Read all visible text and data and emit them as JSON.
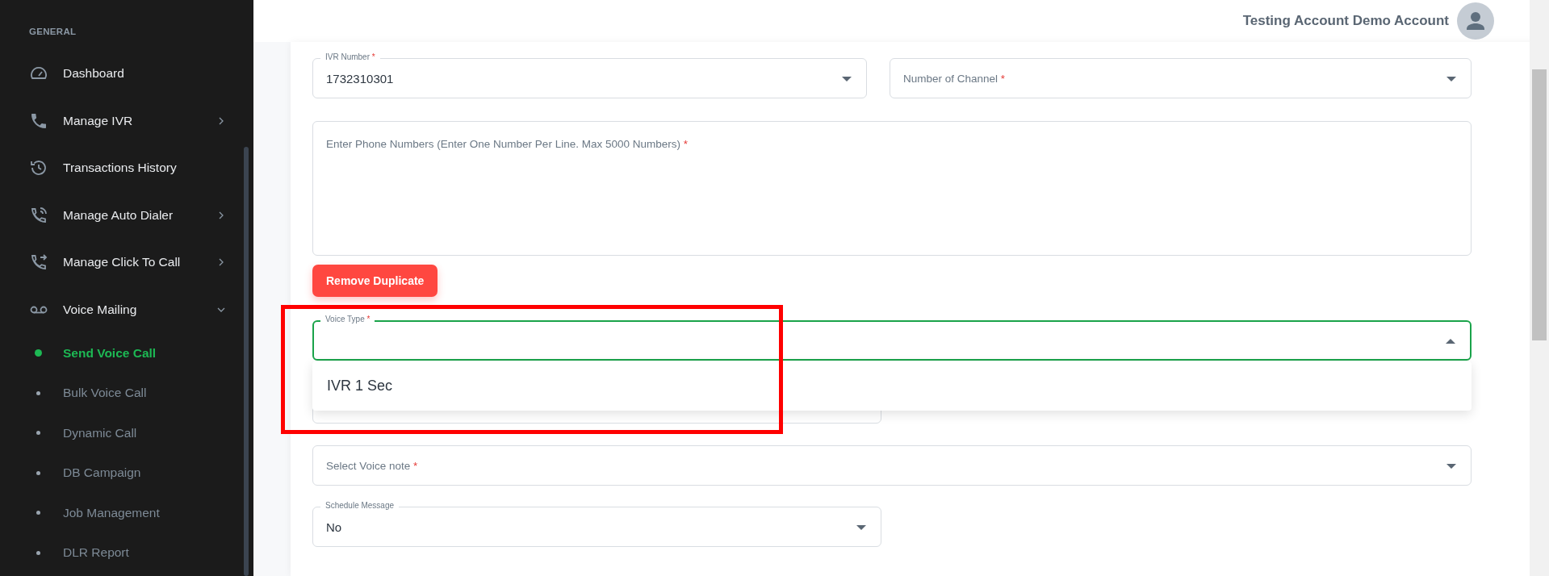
{
  "sidebar": {
    "section": "GENERAL",
    "items": [
      {
        "label": "Dashboard"
      },
      {
        "label": "Manage IVR",
        "expanded": false
      },
      {
        "label": "Transactions History"
      },
      {
        "label": "Manage Auto Dialer",
        "expanded": false
      },
      {
        "label": "Manage Click To Call",
        "expanded": false
      },
      {
        "label": "Voice Mailing",
        "expanded": true,
        "children": [
          {
            "label": "Send Voice Call",
            "selected": true
          },
          {
            "label": "Bulk Voice Call",
            "selected": false
          },
          {
            "label": "Dynamic Call",
            "selected": false
          },
          {
            "label": "DB Campaign",
            "selected": false
          },
          {
            "label": "Job Management",
            "selected": false
          },
          {
            "label": "DLR Report",
            "selected": false
          }
        ]
      }
    ]
  },
  "header": {
    "user_name": "Testing Account Demo Account"
  },
  "form": {
    "ivr_number": {
      "label": "IVR Number",
      "required_mark": "*",
      "value": "1732310301"
    },
    "number_of_channel": {
      "placeholder": "Number of Channel",
      "required_mark": "*"
    },
    "phone_numbers": {
      "placeholder": "Enter Phone Numbers (Enter One Number Per Line. Max 5000 Numbers)",
      "required_mark": "*"
    },
    "remove_duplicate_button": "Remove Duplicate",
    "voice_type": {
      "label": "Voice Type",
      "required_mark": "*",
      "focused": true,
      "options": [
        "IVR 1 Sec"
      ]
    },
    "voice_note": {
      "placeholder": "Select Voice note",
      "required_mark": "*"
    },
    "schedule_message": {
      "label": "Schedule Message",
      "value": "No"
    }
  }
}
